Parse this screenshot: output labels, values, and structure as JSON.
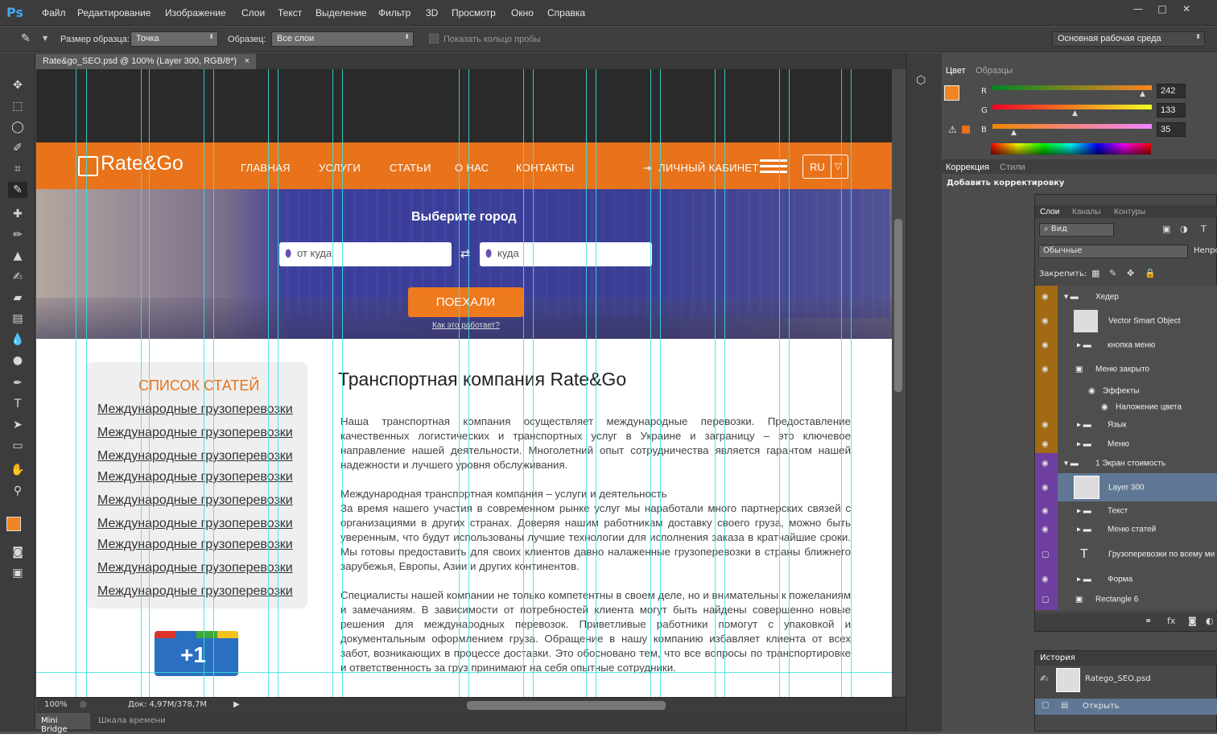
{
  "app": {
    "logo": "Ps"
  },
  "menu": [
    "Файл",
    "Редактирование",
    "Изображение",
    "Слои",
    "Текст",
    "Выделение",
    "Фильтр",
    "3D",
    "Просмотр",
    "Окно",
    "Справка"
  ],
  "options": {
    "sample_size_label": "Размер образца:",
    "sample_size_value": "Точка",
    "sample_label": "Образец:",
    "sample_value": "Все слои",
    "show_ring_label": "Показать кольцо пробы",
    "workspace_value": "Основная рабочая среда"
  },
  "document": {
    "tab_title": "Rate&go_SEO.psd @ 100% (Layer 300, RGB/8*)",
    "close": "×"
  },
  "site": {
    "logo": "Rate&Go",
    "nav": [
      "ГЛАВНАЯ",
      "УСЛУГИ",
      "СТАТЬИ",
      "О НАС",
      "КОНТАКТЫ"
    ],
    "cabinet": "ЛИЧНЫЙ КАБИНЕТ",
    "lang": "RU",
    "choose_city": "Выберите город",
    "from_placeholder": "от куда",
    "to_placeholder": "куда",
    "go_button": "ПОЕХАЛИ",
    "how_it_works": "Как это работает?",
    "sidebar_title": "СПИСОК СТАТЕЙ",
    "articles": [
      "Международные грузоперевозки",
      "Международные грузоперевозки",
      "Международные грузоперевозки",
      "Международные грузоперевозки",
      "Международные грузоперевозки",
      "Международные грузоперевозки",
      "Международные грузоперевозки",
      "Международные грузоперевозки",
      "Международные грузоперевозки"
    ],
    "plus_one": "+1",
    "main_title": "Транспортная компания Rate&Go",
    "para1": "Наша транспортная компания осуществляет международные перевозки. Предоставление качественных логистических и транспортных услуг в Украине и заграницу – это ключевое направление нашей деятельности. Многолетний опыт сотрудничества является гарантом нашей надежности и лучшего уровня обслуживания.",
    "para2_title": "Международная транспортная компания – услуги и деятельность",
    "para2": "За время нашего участия в современном рынке услуг мы наработали много партнерских связей с организациями в других странах. Доверяя нашим работникам доставку своего груза, можно быть уверенным, что будут использованы лучшие технологии для исполнения заказа в кратчайшие сроки. Мы готовы предоставить для своих клиентов давно налаженные грузоперевозки в страны ближнего зарубежья, Европы, Азии и других континентов.",
    "para3": "Специалисты нашей компании не только компетентны в своем деле, но и внимательны к пожеланиям и замечаниям. В зависимости от потребностей клиента могут быть найдены совершенно новые решения для международных перевозок. Приветливые работники помогут с упаковкой и документальным оформлением груза. Обращение в нашу компанию избавляет клиента от всех забот, возникающих в процессе доставки. Это обосновано тем, что все вопросы по транспортировке и ответственность за груз принимают на себя опытные сотрудники."
  },
  "status": {
    "zoom": "100%",
    "doc": "Док: 4,97M/378,7M"
  },
  "bottom_tabs": [
    "Mini Bridge",
    "Шкала времени"
  ],
  "color_panel": {
    "tabs": [
      "Цвет",
      "Образцы"
    ],
    "r_label": "R",
    "g_label": "G",
    "b_label": "B",
    "r": "242",
    "g": "133",
    "b": "35",
    "foreground": "#f28523"
  },
  "correction_panel": {
    "tabs": [
      "Коррекция",
      "Стили"
    ],
    "add": "Добавить корректировку"
  },
  "layers_panel": {
    "tabs": [
      "Слои",
      "Каналы",
      "Контуры"
    ],
    "filter": "Вид",
    "blend": "Обычные",
    "opacity_label": "Непро",
    "lock_label": "Закрепить:",
    "layers": [
      {
        "name": "Хедер",
        "color": "#a36a15"
      },
      {
        "name": "Vector Smart Object",
        "color": "#a36a15"
      },
      {
        "name": "кнопка меню",
        "color": "#a36a15"
      },
      {
        "name": "Меню закрыто",
        "color": "#a36a15"
      },
      {
        "name": "Эффекты",
        "color": "#a36a15"
      },
      {
        "name": "Наложение цвета",
        "color": "#a36a15"
      },
      {
        "name": "Язык",
        "color": "#a36a15"
      },
      {
        "name": "Меню",
        "color": "#a36a15"
      },
      {
        "name": "1 Экран стоимость",
        "color": "#6e3fa0"
      },
      {
        "name": "Layer 300",
        "color": "#6e3fa0"
      },
      {
        "name": "Текст",
        "color": "#6e3fa0"
      },
      {
        "name": "Меню статей",
        "color": "#6e3fa0"
      },
      {
        "name": "Грузоперевозки  по всему ми",
        "color": "#6e3fa0"
      },
      {
        "name": "Форма",
        "color": "#6e3fa0"
      },
      {
        "name": "Rectangle 6",
        "color": "#6e3fa0"
      }
    ]
  },
  "history_panel": {
    "title": "История",
    "items": [
      "Ratego_SEO.psd",
      "Открыть"
    ]
  },
  "colors": {
    "orange": "#e8731b",
    "guide": "#37e3e0",
    "selection": "#5f7794"
  }
}
